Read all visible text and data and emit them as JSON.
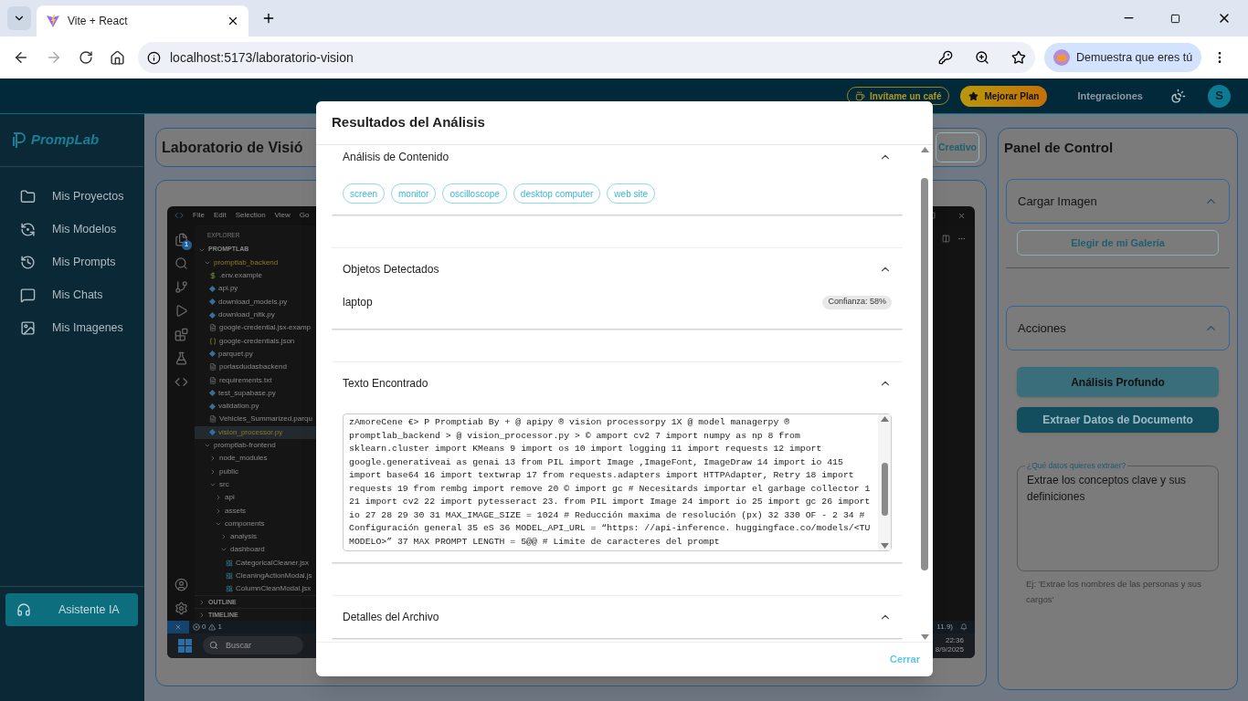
{
  "browser": {
    "tab": {
      "title": "Vite + React",
      "selected": true
    },
    "url": "localhost:5173/laboratorio-vision",
    "profile_button": "Demuestra que eres tú"
  },
  "header": {
    "coffee_button": "Invítame un café",
    "upgrade_button": "Mejorar Plan",
    "integrations_link": "Integraciones",
    "avatar": "S"
  },
  "sidebar": {
    "brand": "PrompLab",
    "items": [
      {
        "label": "Mis Proyectos"
      },
      {
        "label": "Mis Modelos"
      },
      {
        "label": "Mis Prompts"
      },
      {
        "label": "Mis Chats"
      },
      {
        "label": "Mis Imagenes"
      }
    ],
    "assistant_button": "Asistente IA"
  },
  "lab": {
    "title": "Laboratorio de Visió",
    "mode_button": "Creativo",
    "screenshot": {
      "menu": [
        "File",
        "Edit",
        "Selection",
        "View",
        "Go"
      ],
      "explorer_title": "EXPLORER",
      "explorer_badge": "1",
      "root": "PROMPTLAB",
      "tree": [
        {
          "kind": "folder",
          "name": "promptlab_backend",
          "expanded": true,
          "modified": true,
          "selected": false,
          "children": [
            {
              "kind": "env",
              "name": ".env.example",
              "modified": false,
              "selected": false
            },
            {
              "kind": "py",
              "name": "api.py",
              "modified": false,
              "selected": false
            },
            {
              "kind": "py",
              "name": "download_models.py",
              "modified": false,
              "selected": false
            },
            {
              "kind": "py",
              "name": "download_nltk.py",
              "modified": false,
              "selected": false
            },
            {
              "kind": "text",
              "name": "google-credential.jsx-examp",
              "modified": false,
              "selected": false
            },
            {
              "kind": "json",
              "name": "google-credentials.json",
              "modified": false,
              "selected": false
            },
            {
              "kind": "py",
              "name": "parquet.py",
              "modified": false,
              "selected": false
            },
            {
              "kind": "text",
              "name": "porlasdudasbackend",
              "modified": false,
              "selected": false
            },
            {
              "kind": "text",
              "name": "requirements.txt",
              "modified": false,
              "selected": false
            },
            {
              "kind": "py",
              "name": "test_supabase.py",
              "modified": false,
              "selected": false
            },
            {
              "kind": "py",
              "name": "validation.py",
              "modified": false,
              "selected": false
            },
            {
              "kind": "text",
              "name": "Vehicles_Summarized.parqu",
              "modified": false,
              "selected": false
            },
            {
              "kind": "py",
              "name": "vision_processor.py",
              "modified": true,
              "selected": true
            }
          ]
        },
        {
          "kind": "folder",
          "name": "promptlab-frontend",
          "expanded": true,
          "modified": false,
          "selected": false,
          "children": [
            {
              "kind": "folder",
              "name": "node_modules",
              "expanded": false,
              "modified": false,
              "selected": false
            },
            {
              "kind": "folder",
              "name": "public",
              "expanded": false,
              "modified": false,
              "selected": false
            },
            {
              "kind": "folder",
              "name": "src",
              "expanded": true,
              "modified": false,
              "selected": false,
              "children": [
                {
                  "kind": "folder",
                  "name": "api",
                  "expanded": false,
                  "modified": false,
                  "selected": false
                },
                {
                  "kind": "folder",
                  "name": "assets",
                  "expanded": false,
                  "modified": false,
                  "selected": false
                },
                {
                  "kind": "folder",
                  "name": "components",
                  "expanded": true,
                  "modified": false,
                  "selected": false,
                  "children": [
                    {
                      "kind": "folder",
                      "name": "analysis",
                      "expanded": false,
                      "modified": false,
                      "selected": false
                    },
                    {
                      "kind": "folder",
                      "name": "dashboard",
                      "expanded": true,
                      "modified": false,
                      "selected": false,
                      "children": [
                        {
                          "kind": "react",
                          "name": "CategoricalCleaner.jsx",
                          "modified": false,
                          "selected": false
                        },
                        {
                          "kind": "react",
                          "name": "CleaningActionModal.js",
                          "modified": false,
                          "selected": false
                        },
                        {
                          "kind": "react",
                          "name": "ColumnCleanModal.jsx",
                          "modified": false,
                          "selected": false
                        }
                      ]
                    }
                  ]
                }
              ]
            }
          ]
        }
      ],
      "sections": [
        "OUTLINE",
        "TIMELINE"
      ],
      "errors": "0",
      "warnings": "1",
      "status_right": "11.9)",
      "search": "Buscar",
      "time": "22:36",
      "date": "8/9/2025"
    }
  },
  "panel": {
    "title": "Panel de Control",
    "upload": {
      "title": "Cargar Imagen",
      "expanded": true,
      "gallery_button": "Elegir de mi Galería"
    },
    "actions": {
      "title": "Acciones",
      "expanded": true,
      "deep_button": "Análisis Profundo",
      "extract_button": "Extraer Datos de Documento",
      "field_label": "¿Qué datos quieres extraer?",
      "field_value": "Extrae los conceptos clave y sus definiciones",
      "hint": "Ej: 'Extrae los nombres de las personas y sus cargos'"
    }
  },
  "modal": {
    "title": "Resultados del Análisis",
    "sections": [
      {
        "kind": "tags",
        "title": "Análisis de Contenido",
        "expanded": true,
        "tags": [
          "screen",
          "monitor",
          "oscilloscope",
          "desktop computer",
          "web site"
        ]
      },
      {
        "kind": "objects",
        "title": "Objetos Detectados",
        "expanded": true,
        "objects": [
          {
            "name": "laptop",
            "confidence": "Confianza: 58%"
          }
        ]
      },
      {
        "kind": "text",
        "title": "Texto Encontrado",
        "expanded": true,
        "text": "zAmoreCene  €> P Promptiab By + @ apipy ® vision processorpy 1X @ model managerpy ® promptlab_backend > @ vision_processor.py > © amport cv2 7 import numpy as np 8 from sklearn.cluster import KMeans 9 import os 10 import logging 11 import requests 12 import google.generativeai as genai 13 from PIL import Image ,ImageFont, ImageDraw 14 import io 415 import base64 16 import textwrap 17 from requests.adapters import HTTPAdapter, Retry 18 import requests 19 from rembg import remove 20 © import gc # Necesitards importar el garbage collector 1 21 import cv2 22 import pytesseract 23. from PIL import Image 24 import io 25 import gc 26 import io 27 28 29 30 31 MAX_IMAGE_SIZE = 1024 # Reducción maxima de resolución (px) 32 330 OF - 2 34 # Configuración general 35 eS 36 MODEL_API_URL = “https: //api-inference. huggingface.co/models/<TU MODELO>” 37 MAX PROMPT LENGTH = 5@@ # Limite de caracteres del prompt"
      },
      {
        "kind": "details",
        "title": "Detalles del Archivo",
        "expanded": true
      }
    ],
    "close_button": "Cerrar"
  }
}
